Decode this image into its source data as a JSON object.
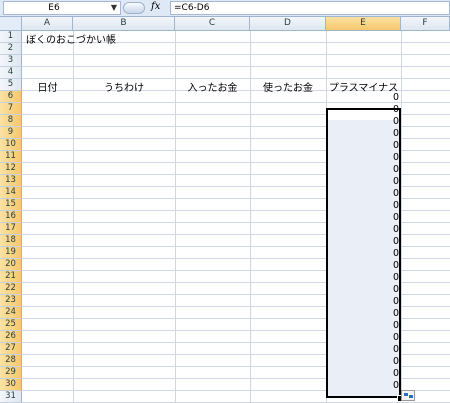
{
  "formula_bar": {
    "name_box": "E6",
    "fx_label": "fx",
    "formula": "=C6-D6"
  },
  "columns": [
    "A",
    "B",
    "C",
    "D",
    "E",
    "F"
  ],
  "active_column": "E",
  "rows": [
    "1",
    "2",
    "3",
    "4",
    "5",
    "6",
    "7",
    "8",
    "9",
    "10",
    "11",
    "12",
    "13",
    "14",
    "15",
    "16",
    "17",
    "18",
    "19",
    "20",
    "21",
    "22",
    "23",
    "24",
    "25",
    "26",
    "27",
    "28",
    "29",
    "30",
    "31"
  ],
  "cells": {
    "a1": "ぼくのおこづかい帳",
    "headers": {
      "a5": "日付",
      "b5": "うちわけ",
      "c5": "入ったお金",
      "d5": "使ったお金",
      "e5": "プラスマイナス"
    },
    "e_values": [
      "0",
      "0",
      "0",
      "0",
      "0",
      "0",
      "0",
      "0",
      "0",
      "0",
      "0",
      "0",
      "0",
      "0",
      "0",
      "0",
      "0",
      "0",
      "0",
      "0",
      "0",
      "0",
      "0",
      "0",
      "0"
    ]
  },
  "colors": {
    "selection_fill": "#e9eef7",
    "active_header": "#f6c76b",
    "header_bg": "#e0e7f1"
  }
}
